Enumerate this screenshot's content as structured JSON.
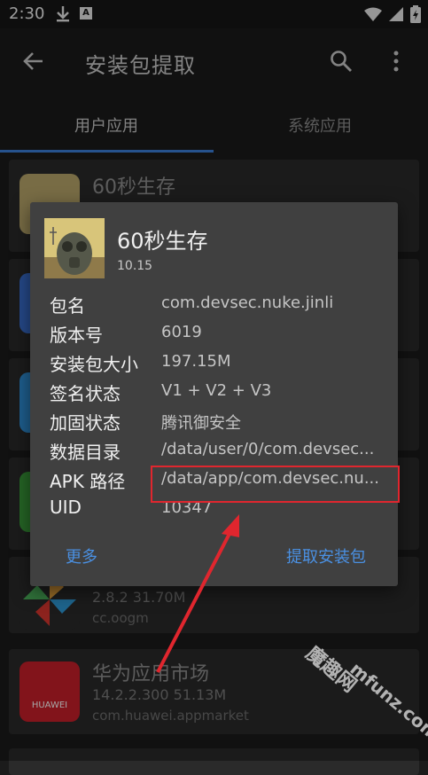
{
  "status": {
    "time": "2:30",
    "a_icon": "A"
  },
  "appbar": {
    "title": "安装包提取"
  },
  "tabs": {
    "user": "用户应用",
    "system": "系统应用"
  },
  "list": [
    {
      "name": "60秒生存",
      "version_size": "",
      "package": ""
    },
    {
      "name": "",
      "version_size": "2.8.2   31.70M",
      "package": "cc.oogm"
    },
    {
      "name": "华为应用市场",
      "version_size": "14.2.2.300   51.13M",
      "package": "com.huawei.appmarket",
      "icon_label": "HUAWEI"
    }
  ],
  "dialog": {
    "app_name": "60秒生存",
    "app_version": "10.15",
    "rows": [
      {
        "key": "包名",
        "value": "com.devsec.nuke.jinli"
      },
      {
        "key": "版本号",
        "value": "6019"
      },
      {
        "key": "安装包大小",
        "value": "197.15M"
      },
      {
        "key": "签名状态",
        "value": "V1 + V2 + V3"
      },
      {
        "key": "加固状态",
        "value": "腾讯御安全"
      },
      {
        "key": "数据目录",
        "value": "/data/user/0/com.devsec..."
      },
      {
        "key": "APK 路径",
        "value": "/data/app/com.devsec.nu..."
      },
      {
        "key": "UID",
        "value": "10347"
      }
    ],
    "more_label": "更多",
    "extract_label": "提取安装包"
  },
  "watermark": {
    "line1": "魔趣网",
    "line2": "mfunz.com"
  },
  "colors": {
    "accent": "#4a90e2",
    "highlight": "#e0262e"
  }
}
